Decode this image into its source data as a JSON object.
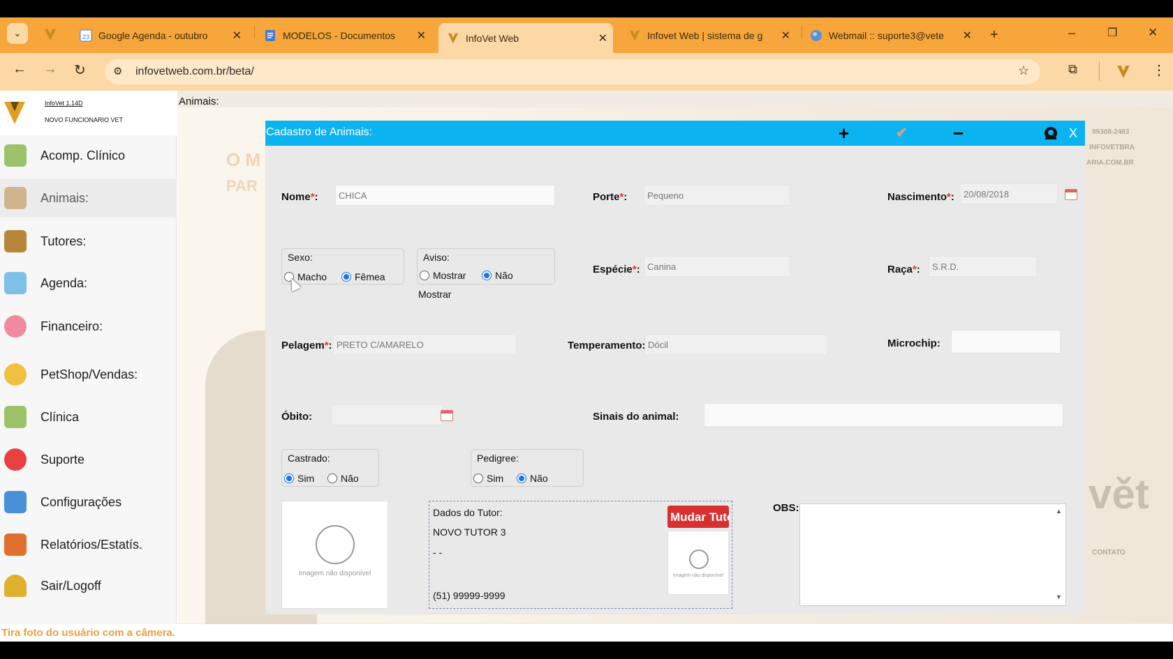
{
  "browser": {
    "tabs": [
      {
        "title": "Google Agenda - outubro",
        "icon": "calendar-icon"
      },
      {
        "title": "MODELOS - Documentos",
        "icon": "docs-icon"
      },
      {
        "title": "InfoVet Web",
        "icon": "infovet-icon",
        "active": true
      },
      {
        "title": "Infovet Web | sistema de g",
        "icon": "infovet-icon"
      },
      {
        "title": "Webmail :: suporte3@vete",
        "icon": "webmail-icon"
      }
    ],
    "new_tab": "+",
    "url": "infovetweb.com.br/beta/",
    "window_controls": {
      "minimize": "–",
      "restore": "❐",
      "close": "✕"
    }
  },
  "sidebar": {
    "version": "InfoVet 1.14D",
    "user": "NOVO FUNCIONARIO VET",
    "items": [
      {
        "label": "Acomp. Clínico",
        "icon": "clinic-icon",
        "color": "#9cc36a"
      },
      {
        "label": "Animais:",
        "icon": "dog-icon",
        "color": "#d2b48c",
        "active": true
      },
      {
        "label": "Tutores:",
        "icon": "person-icon",
        "color": "#b8863b"
      },
      {
        "label": "Agenda:",
        "icon": "calendar-icon",
        "color": "#7fc0e6"
      },
      {
        "label": "Financeiro:",
        "icon": "piggy-bank-icon",
        "color": "#f08aa0"
      },
      {
        "label": "PetShop/Vendas:",
        "icon": "coins-icon",
        "color": "#f0c040"
      },
      {
        "label": "Clínica",
        "icon": "clinic-icon",
        "color": "#9cc36a"
      },
      {
        "label": "Suporte",
        "icon": "lifebuoy-icon",
        "color": "#e84040"
      },
      {
        "label": "Configurações",
        "icon": "tools-icon",
        "color": "#4a90d9"
      },
      {
        "label": "Relatórios/Estatís.",
        "icon": "chart-icon",
        "color": "#e07030"
      },
      {
        "label": "Sair/Logoff",
        "icon": "padlock-icon",
        "color": "#e0b030"
      }
    ]
  },
  "content": {
    "label": "Animais:",
    "bg_text_1": "O M",
    "bg_text_2": "PAR",
    "contact_1": "99308-2483",
    "contact_2": "INFOVETBRA",
    "contact_3": "ARIA.COM.BR",
    "contact_4": "CONTATO"
  },
  "modal": {
    "title": "Cadastro de Animais:",
    "actions": {
      "add": "+",
      "save": "✔",
      "remove": "−"
    },
    "close": "X",
    "nome_label": "Nome",
    "nome_value": "CHICA",
    "porte_label": "Porte",
    "porte_value": "Pequeno",
    "nascimento_label": "Nascimento",
    "nascimento_value": "20/08/2018",
    "sexo": {
      "title": "Sexo:",
      "options": [
        "Macho",
        "Fêmea"
      ],
      "selected": "Fêmea"
    },
    "aviso": {
      "title": "Aviso:",
      "options": [
        "Mostrar",
        "Não"
      ],
      "extra": "Mostrar",
      "selected": "Não"
    },
    "especie_label": "Espécie",
    "especie_value": "Canina",
    "raca_label": "Raça",
    "raca_value": "S.R.D.",
    "pelagem_label": "Pelagem",
    "pelagem_value": "PRETO C/AMARELO",
    "temperamento_label": "Temperamento:",
    "temperamento_value": "Dócil",
    "microchip_label": "Microchip:",
    "microchip_value": "",
    "obito_label": "Óbito:",
    "obito_value": "",
    "sinais_label": "Sinais do animal:",
    "sinais_value": "",
    "castrado": {
      "title": "Castrado:",
      "options": [
        "Sim",
        "Não"
      ],
      "selected": "Sim"
    },
    "pedigree": {
      "title": "Pedigree:",
      "options": [
        "Sim",
        "Não"
      ],
      "selected": "Não"
    },
    "photo_text": "Imagem não disponível",
    "tutor": {
      "title": "Dados do Tutor:",
      "name": "NOVO TUTOR 3",
      "line2": "- -",
      "phone": "(51) 99999-9999",
      "change_button": "Mudar Tutor",
      "photo_text": "Imagem não disponível"
    },
    "obs_label": "OBS:",
    "obs_value": ""
  },
  "status": {
    "text": "Tira foto do usuário com a câmera."
  }
}
